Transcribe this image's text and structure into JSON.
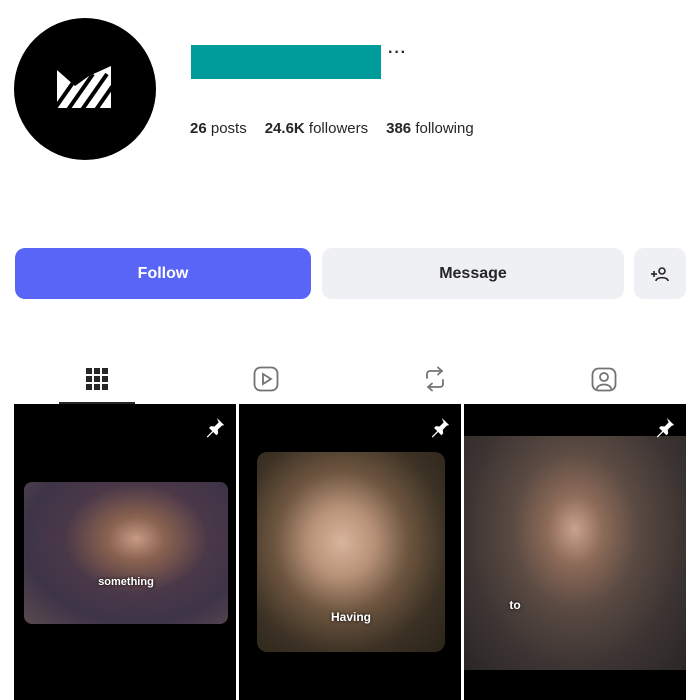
{
  "profile": {
    "avatar_icon": "brand-logo-icon",
    "more_label": "···",
    "username_redaction_color": "#009c9c"
  },
  "stats": {
    "posts_count": "26",
    "posts_label": "posts",
    "followers_count": "24.6K",
    "followers_label": "followers",
    "following_count": "386",
    "following_label": "following"
  },
  "actions": {
    "follow_label": "Follow",
    "message_label": "Message",
    "add_user_icon": "add-person-icon",
    "accent": "#5865f7"
  },
  "tabs": [
    {
      "icon": "grid-icon",
      "active": true
    },
    {
      "icon": "reels-icon",
      "active": false
    },
    {
      "icon": "repost-icon",
      "active": false
    },
    {
      "icon": "tagged-icon",
      "active": false
    }
  ],
  "posts": [
    {
      "caption": "something",
      "pinned": true
    },
    {
      "caption": "Having",
      "pinned": true
    },
    {
      "caption": "to",
      "pinned": true
    }
  ]
}
